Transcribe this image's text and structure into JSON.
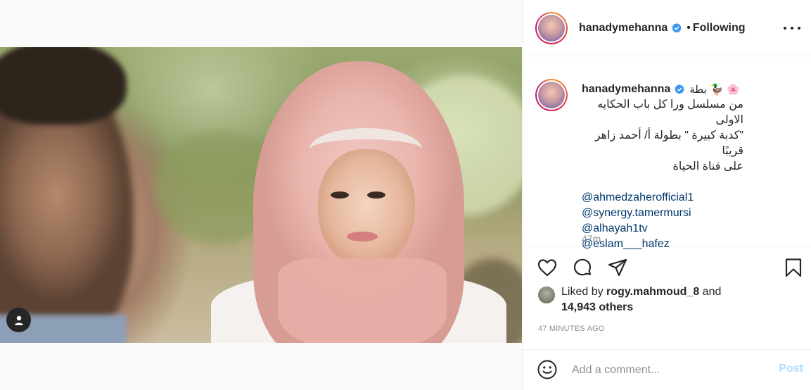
{
  "post": {
    "username": "hanadymehanna",
    "verified": true,
    "follow_separator": "•",
    "follow_state": "Following"
  },
  "caption": {
    "username": "hanadymehanna",
    "emoji_line": "بطة 🦆 🌸",
    "lines": [
      "من مسلسل ورا كل باب الحكايه الاولى",
      "\"كدبة كبيرة \" بطولة أ/ أحمد زاهر قريبًا",
      "على قناة الحياة"
    ],
    "mentions": [
      "@ahmedzaherofficial1",
      "@synergy.tamermursi",
      "@alhayah1tv",
      "@eslam___hafez"
    ],
    "age": "47m"
  },
  "actions": {
    "like_icon": "heart-icon",
    "comment_icon": "comment-icon",
    "share_icon": "share-icon",
    "save_icon": "bookmark-icon"
  },
  "likes": {
    "prefix": "Liked by",
    "liker": "rogy.mahmoud_8",
    "conj": "and",
    "others": "14,943 others"
  },
  "posted_time": "47 MINUTES AGO",
  "comment": {
    "placeholder": "Add a comment...",
    "post_label": "Post"
  },
  "colors": {
    "link": "#00376b",
    "verified": "#3897f0",
    "post_disabled": "#b2dffc"
  }
}
